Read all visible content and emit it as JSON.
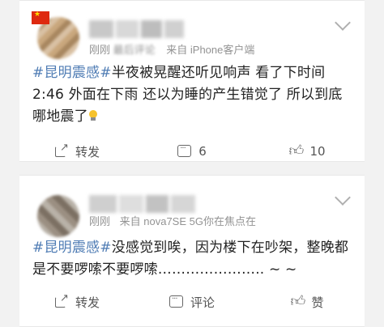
{
  "posts": [
    {
      "flag_icon": "china-flag-icon",
      "meta_time": "刚刚",
      "meta_hint": "最后评论",
      "meta_source": "来自 iPhone客户端",
      "hashtag": "#昆明震感#",
      "text": "半夜被晃醒还听见响声 看了下时间2:46 外面在下雨 还以为睡的产生错觉了 所以到底哪地震了",
      "emoji": "lightbulb-icon",
      "actions": {
        "repost_label": "转发",
        "comment_count": "6",
        "like_count": "10"
      }
    },
    {
      "meta_time": "刚刚",
      "meta_source": "来自 nova7SE 5G你在焦点在",
      "hashtag": "#昆明震感#",
      "text": "没感觉到唉，因为楼下在吵架，整晚都是不要啰嗦不要啰嗦………………….. ~ ~",
      "actions": {
        "repost_label": "转发",
        "comment_label": "评论",
        "like_label": "赞"
      }
    }
  ],
  "colors": {
    "hashtag": "#4f7cb4",
    "background": "#f2f2f2",
    "card": "#ffffff"
  }
}
